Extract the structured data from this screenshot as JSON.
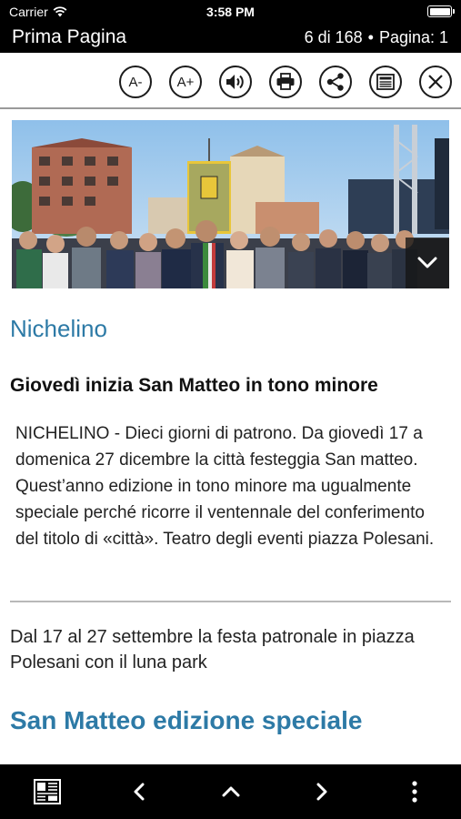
{
  "status_bar": {
    "carrier": "Carrier",
    "time": "3:58 PM"
  },
  "header": {
    "title": "Prima Pagina",
    "position": "6 di 168",
    "separator": "•",
    "page": "Pagina: 1"
  },
  "toolbar": {
    "font_decrease_label": "A-",
    "font_increase_label": "A+",
    "icons": [
      "font-decrease-icon",
      "font-increase-icon",
      "speaker-icon",
      "print-icon",
      "share-icon",
      "newspaper-icon",
      "close-icon"
    ]
  },
  "article": {
    "section": "Nichelino",
    "title": "Giovedì inizia San Matteo in tono minore",
    "body": "NICHELINO - Dieci giorni di patrono. Da giovedì 17 a domenica 27 dicembre la città festeggia San matteo. Quest’anno edizione in tono minore ma ugualmente speciale perché ricorre il ventennale del conferimento del titolo di «città». Teatro degli eventi piazza Polesani.",
    "subtitle": "Dal 17 al 27 settembre la festa patronale in piazza Polesani con il luna park",
    "next_headline": "San Matteo edizione speciale"
  },
  "colors": {
    "accent": "#2d7aa6",
    "bars": "#000000"
  },
  "bottom_bar": {
    "icons": [
      "page-grid-icon",
      "chevron-left-icon",
      "chevron-up-icon",
      "chevron-right-icon",
      "more-vertical-icon"
    ]
  }
}
